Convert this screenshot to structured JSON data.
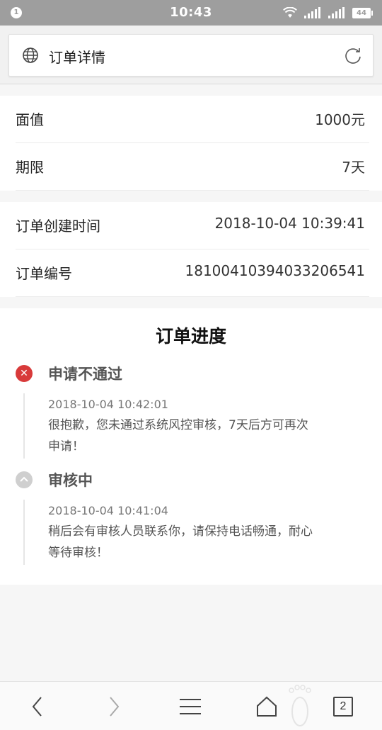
{
  "status_bar": {
    "notification_count": "1",
    "time": "10:43",
    "battery": "44"
  },
  "address_bar": {
    "title": "订单详情"
  },
  "card_1": {
    "rows": [
      {
        "label": "面值",
        "value": "1000元"
      },
      {
        "label": "期限",
        "value": "7天"
      }
    ]
  },
  "card_2": {
    "rows": [
      {
        "label": "订单创建时间",
        "value": "2018-10-04 10:39:41"
      },
      {
        "label": "订单编号",
        "value": "181004103940332065‌41"
      }
    ]
  },
  "progress": {
    "title": "订单进度",
    "steps": [
      {
        "title": "申请不通过",
        "status_color": "#d83a3a",
        "icon": "x-icon",
        "timestamp": "2018-10-04 10:42:01",
        "message": "很抱歉，您未通过系统风控审核，7天后方可再次申请！"
      },
      {
        "title": "审核中",
        "status_color": "#cfcfcf",
        "icon": "chevron-up-icon",
        "timestamp": "2018-10-04 10:41:04",
        "message": "稍后会有审核人员联系你，请保持电话畅通，耐心等待审核！"
      }
    ]
  },
  "bottom_bar": {
    "tab_count": "2"
  }
}
